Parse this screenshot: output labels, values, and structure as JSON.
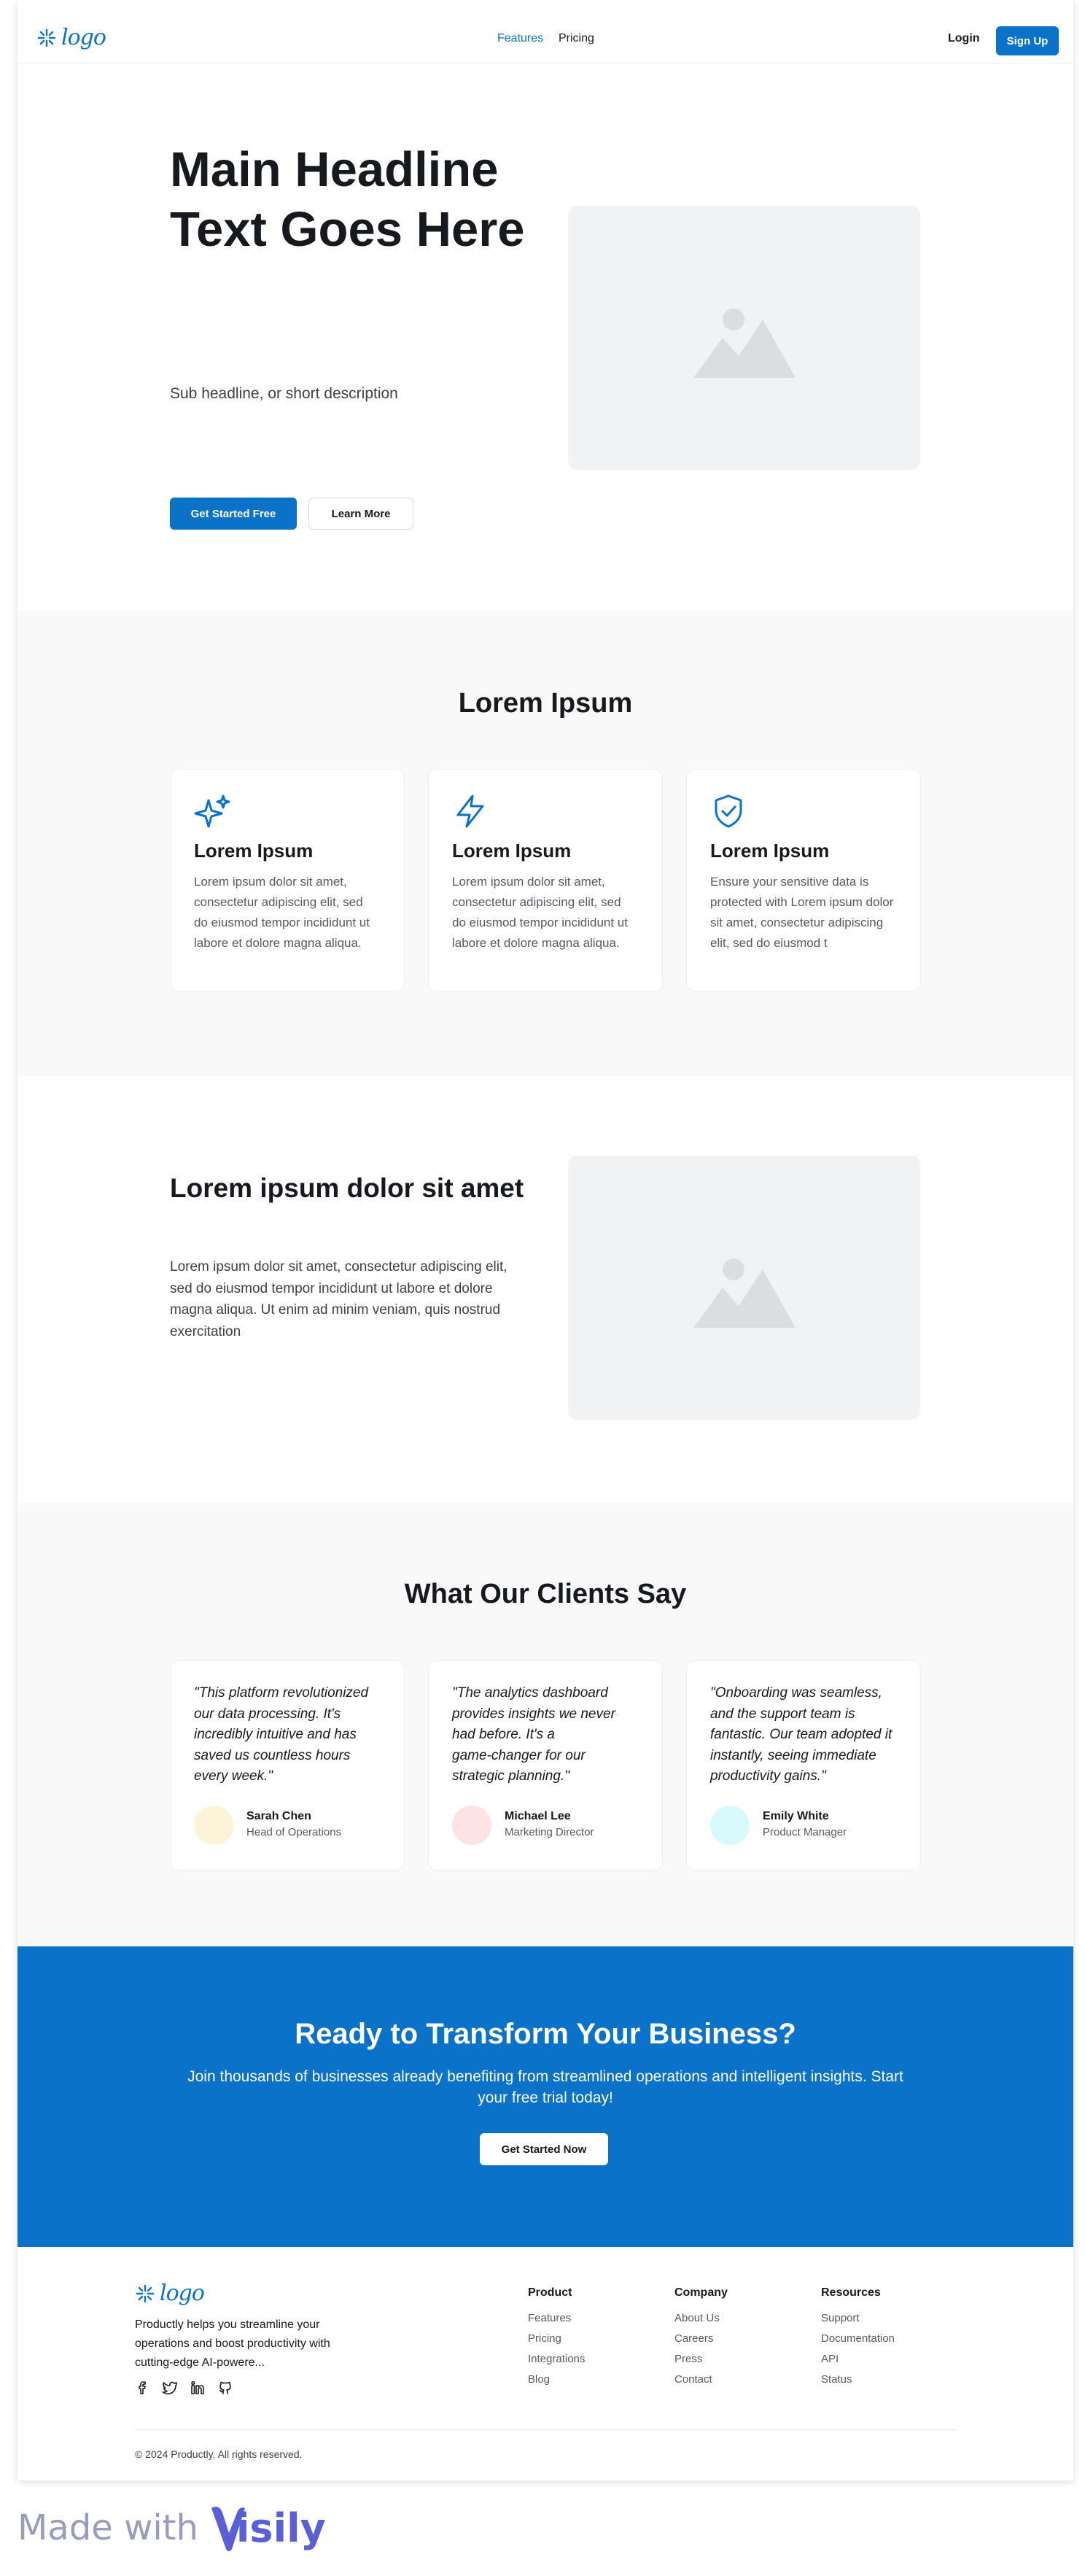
{
  "header": {
    "logo_text": "logo",
    "nav": [
      "Features",
      "Pricing"
    ],
    "login": "Login",
    "signup": "Sign Up"
  },
  "hero": {
    "headline_line1": "Main Headline",
    "headline_line2": "Text Goes Here",
    "subheadline": "Sub headline, or short description",
    "primary_cta": "Get Started Free",
    "secondary_cta": "Learn More"
  },
  "features": {
    "title": "Lorem Ipsum",
    "cards": [
      {
        "icon": "sparkles-icon",
        "title": "Lorem Ipsum",
        "lines": [
          "Lorem ipsum dolor sit amet,",
          "consectetur adipiscing elit, sed",
          "do eiusmod tempor incididunt ut",
          "labore et dolore magna aliqua."
        ]
      },
      {
        "icon": "lightning-icon",
        "title": "Lorem Ipsum",
        "lines": [
          "Lorem ipsum dolor sit amet,",
          "consectetur adipiscing elit, sed",
          "do eiusmod tempor incididunt ut",
          "labore et dolore magna aliqua."
        ]
      },
      {
        "icon": "shield-check-icon",
        "title": "Lorem Ipsum",
        "lines": [
          "Ensure your sensitive data is",
          "protected with Lorem ipsum dolor",
          "sit amet, consectetur adipiscing",
          "elit, sed do eiusmod t"
        ]
      }
    ]
  },
  "content": {
    "title": "Lorem ipsum dolor sit amet",
    "lines": [
      "Lorem ipsum dolor sit amet, consectetur adipiscing elit,",
      "sed do eiusmod tempor incididunt ut labore et dolore",
      "magna aliqua. Ut enim ad minim veniam, quis nostrud",
      "exercitation"
    ]
  },
  "testimonials": {
    "title": "What Our Clients Say",
    "items": [
      {
        "quote_lines": [
          "\"This platform revolutionized",
          "our data processing. It's",
          "incredibly intuitive and has",
          "saved us countless hours",
          "every week.\""
        ],
        "name": "Sarah Chen",
        "role": "Head of Operations",
        "avatar_color": "#fdf3d8"
      },
      {
        "quote_lines": [
          "\"The analytics dashboard",
          "provides insights we never",
          "had before. It's a",
          "game-changer for our",
          "strategic planning.\""
        ],
        "name": "Michael Lee",
        "role": "Marketing Director",
        "avatar_color": "#fde2e6"
      },
      {
        "quote_lines": [
          "\"Onboarding was seamless,",
          "and the support team is",
          "fantastic. Our team adopted it",
          "instantly, seeing immediate",
          "productivity gains.\""
        ],
        "name": "Emily White",
        "role": "Product Manager",
        "avatar_color": "#d9fafd"
      }
    ]
  },
  "cta": {
    "title": "Ready to Transform Your Business?",
    "line1": "Join thousands of businesses already benefiting from streamlined operations and intelligent insights. Start",
    "line2": "your free trial today!",
    "button": "Get Started Now"
  },
  "footer": {
    "logo_text": "logo",
    "desc_lines": [
      "Productly helps you streamline your",
      "operations and boost productivity with",
      "cutting-edge AI-powere..."
    ],
    "columns": [
      {
        "title": "Product",
        "links": [
          "Features",
          "Pricing",
          "Integrations",
          "Blog"
        ]
      },
      {
        "title": "Company",
        "links": [
          "About Us",
          "Careers",
          "Press",
          "Contact"
        ]
      },
      {
        "title": "Resources",
        "links": [
          "Support",
          "Documentation",
          "API",
          "Status"
        ]
      }
    ],
    "copyright": "© 2024 Productly. All rights reserved."
  },
  "badge": {
    "prefix": "Made with",
    "brand": "Visily"
  },
  "colors": {
    "accent": "#0a72c8",
    "section_gray": "#f9f9f9",
    "placeholder": "#f1f2f4",
    "brand_purple": "#5b5fd6"
  }
}
